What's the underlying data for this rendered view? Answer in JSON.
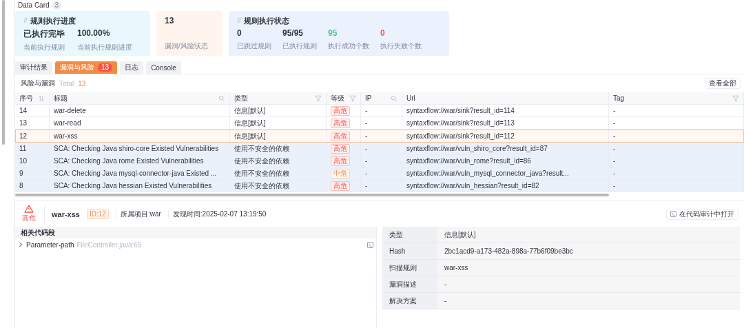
{
  "data_card": {
    "title": "Data Card",
    "count": "3"
  },
  "cards": [
    {
      "kind": "progress",
      "icon": "#",
      "title": "规则执行进度",
      "stats": [
        {
          "value": "已执行完毕",
          "label": "当前执行规则",
          "kind": "default"
        },
        {
          "value": "100.00%",
          "label": "当前执行规则进度",
          "kind": "default"
        }
      ]
    },
    {
      "kind": "risk",
      "stats": [
        {
          "value": "13",
          "label": "漏洞/风险状态",
          "kind": "default"
        }
      ]
    },
    {
      "kind": "status",
      "icon": "#",
      "title": "规则执行状态",
      "stats": [
        {
          "value": "0",
          "label": "已跳过规则",
          "kind": "default"
        },
        {
          "value": "95/95",
          "label": "已执行规则",
          "kind": "default"
        },
        {
          "value": "95",
          "label": "执行成功个数",
          "kind": "success"
        },
        {
          "value": "0",
          "label": "执行失败个数",
          "kind": "error"
        }
      ]
    }
  ],
  "tabs": [
    {
      "label": "审计结果",
      "selected": false
    },
    {
      "label": "漏洞与风险",
      "count": "13",
      "selected": true
    },
    {
      "label": "日志",
      "selected": false
    },
    {
      "label": "Console",
      "selected": false
    }
  ],
  "table": {
    "title": "风险与漏洞",
    "total_label": "Total",
    "total": "13",
    "view_all": "查看全部",
    "columns": [
      {
        "label": "序号",
        "kind": "sort"
      },
      {
        "label": "标题",
        "kind": "search"
      },
      {
        "label": "类型",
        "kind": "filter"
      },
      {
        "label": "等级",
        "kind": "filter"
      },
      {
        "label": "IP",
        "kind": "search"
      },
      {
        "label": "Url",
        "kind": "plain"
      },
      {
        "label": "Tag",
        "kind": "filter"
      }
    ],
    "rows": [
      {
        "no": "14",
        "title": "war-delete",
        "type": "信息[默认]",
        "level": {
          "label": "高危",
          "kind": "high"
        },
        "ip": "-",
        "url": "syntaxflow://war/sink?result_id=114",
        "tag": "-",
        "selected": false,
        "shaded": false
      },
      {
        "no": "13",
        "title": "war-read",
        "type": "信息[默认]",
        "level": {
          "label": "高危",
          "kind": "high"
        },
        "ip": "-",
        "url": "syntaxflow://war/sink?result_id=113",
        "tag": "-",
        "selected": false,
        "shaded": false
      },
      {
        "no": "12",
        "title": "war-xss",
        "type": "信息[默认]",
        "level": {
          "label": "高危",
          "kind": "high"
        },
        "ip": "-",
        "url": "syntaxflow://war/sink?result_id=112",
        "tag": "-",
        "selected": true,
        "shaded": false
      },
      {
        "no": "11",
        "title": "SCA: Checking Java shiro-core Existed Vulnerabilities",
        "type": "使用不安全的依赖",
        "level": {
          "label": "高危",
          "kind": "high"
        },
        "ip": "-",
        "url": "syntaxflow://war/vuln_shiro_core?result_id=87",
        "tag": "-",
        "selected": false,
        "shaded": true
      },
      {
        "no": "10",
        "title": "SCA: Checking Java rome Existed Vulnerabilities",
        "type": "使用不安全的依赖",
        "level": {
          "label": "高危",
          "kind": "high"
        },
        "ip": "-",
        "url": "syntaxflow://war/vuln_rome?result_id=86",
        "tag": "-",
        "selected": false,
        "shaded": true
      },
      {
        "no": "9",
        "title": "SCA: Checking Java mysql-connector-java Existed ...",
        "type": "使用不安全的依赖",
        "level": {
          "label": "中危",
          "kind": "medium"
        },
        "ip": "-",
        "url": "syntaxflow://war/vuln_mysql_connector_java?result...",
        "tag": "-",
        "selected": false,
        "shaded": true
      },
      {
        "no": "8",
        "title": "SCA: Checking Java hessian Existed Vulnerabilities",
        "type": "使用不安全的依赖",
        "level": {
          "label": "高危",
          "kind": "high"
        },
        "ip": "-",
        "url": "syntaxflow://war/vuln_hessian?result_id=82",
        "tag": "-",
        "selected": false,
        "shaded": true
      }
    ]
  },
  "detail": {
    "severity": {
      "label": "高危",
      "kind": "high"
    },
    "title": "war-xss",
    "id": "ID:12",
    "project": "所属项目:war",
    "found": "发现时间:2025-02-07 13:19:50",
    "open_button": "在代码审计中打开",
    "code_section": {
      "title": "相关代码段",
      "items": [
        {
          "name": "Parameter-path",
          "file": "FileController.java:65",
          "expanded": false
        }
      ]
    },
    "info": [
      {
        "label": "类型",
        "value": "信息[默认]"
      },
      {
        "label": "Hash",
        "value": "2bc1acd9-a173-482a-898a-77b6f09be3bc"
      },
      {
        "label": "扫描规则",
        "value": "war-xss"
      },
      {
        "label": "漏洞描述",
        "value": "-"
      },
      {
        "label": "解决方案",
        "value": "-"
      }
    ]
  }
}
